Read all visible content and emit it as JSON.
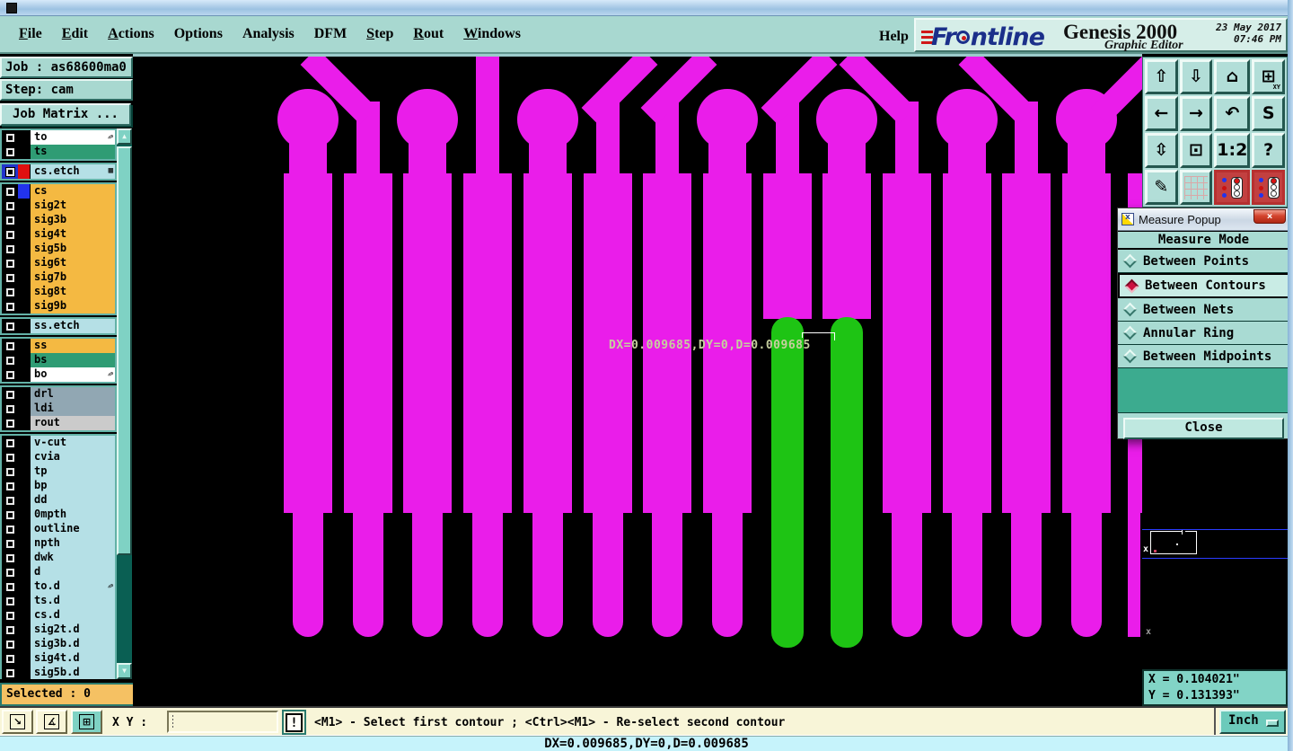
{
  "window": {
    "help_label": "Help"
  },
  "menu": {
    "items": [
      {
        "label": "File",
        "u": true
      },
      {
        "label": "Edit",
        "u": true
      },
      {
        "label": "Actions",
        "u": true
      },
      {
        "label": "Options",
        "u": false
      },
      {
        "label": "Analysis",
        "u": false
      },
      {
        "label": "DFM",
        "u": false
      },
      {
        "label": "Step",
        "u": true
      },
      {
        "label": "Rout",
        "u": true
      },
      {
        "label": "Windows",
        "u": true
      }
    ]
  },
  "brand": {
    "logo_text": "Frontline",
    "product": "Genesis 2000",
    "date": "23 May 2017",
    "time": "07:46 PM",
    "subtitle": "Graphic Editor"
  },
  "sidebar": {
    "job_label": "Job : as68600ma0",
    "step_label": "Step: cam",
    "job_matrix_label": "Job Matrix ...",
    "selected_label": "Selected : 0",
    "colors": {
      "white": "#ffffff",
      "green": "#2f9c74",
      "cyan": "#b5e0e6",
      "orange": "#f4b942",
      "slate": "#91a7b3",
      "gray": "#cbcbcb"
    },
    "groups": [
      [
        {
          "label": "to",
          "bg": "white",
          "arrow": true
        },
        {
          "label": "ts",
          "bg": "green"
        }
      ],
      [
        {
          "label": "cs.etch",
          "bg": "cyan",
          "swatch": "#e01010",
          "checkbox_hl": "#2233cc",
          "grid": true
        }
      ],
      [
        {
          "label": "cs",
          "bg": "orange",
          "swatch": "#2233ee"
        },
        {
          "label": "sig2t",
          "bg": "orange"
        },
        {
          "label": "sig3b",
          "bg": "orange"
        },
        {
          "label": "sig4t",
          "bg": "orange"
        },
        {
          "label": "sig5b",
          "bg": "orange"
        },
        {
          "label": "sig6t",
          "bg": "orange"
        },
        {
          "label": "sig7b",
          "bg": "orange"
        },
        {
          "label": "sig8t",
          "bg": "orange"
        },
        {
          "label": "sig9b",
          "bg": "orange"
        }
      ],
      [
        {
          "label": "ss.etch",
          "bg": "cyan"
        }
      ],
      [
        {
          "label": "ss",
          "bg": "orange"
        },
        {
          "label": "bs",
          "bg": "green"
        },
        {
          "label": "bo",
          "bg": "white",
          "arrow": true
        }
      ],
      [
        {
          "label": "drl",
          "bg": "slate"
        },
        {
          "label": "ldi",
          "bg": "slate"
        },
        {
          "label": "rout",
          "bg": "gray"
        }
      ],
      [
        {
          "label": "v-cut",
          "bg": "cyan"
        },
        {
          "label": "cvia",
          "bg": "cyan"
        },
        {
          "label": "tp",
          "bg": "cyan"
        },
        {
          "label": "bp",
          "bg": "cyan"
        },
        {
          "label": "dd",
          "bg": "cyan"
        },
        {
          "label": "0mpth",
          "bg": "cyan"
        },
        {
          "label": "outline",
          "bg": "cyan"
        },
        {
          "label": "npth",
          "bg": "cyan"
        },
        {
          "label": "dwk",
          "bg": "cyan"
        },
        {
          "label": "d",
          "bg": "cyan"
        },
        {
          "label": "to.d",
          "bg": "cyan",
          "arrow": true
        },
        {
          "label": "ts.d",
          "bg": "cyan"
        },
        {
          "label": "cs.d",
          "bg": "cyan"
        },
        {
          "label": "sig2t.d",
          "bg": "cyan"
        },
        {
          "label": "sig3b.d",
          "bg": "cyan"
        },
        {
          "label": "sig4t.d",
          "bg": "cyan"
        },
        {
          "label": "sig5b.d",
          "bg": "cyan"
        }
      ]
    ]
  },
  "toolbar": {
    "buttons": [
      {
        "name": "view-page-up-icon",
        "glyph": "⇧"
      },
      {
        "name": "view-page-down-icon",
        "glyph": "⇩"
      },
      {
        "name": "home-view-icon",
        "glyph": "⌂"
      },
      {
        "name": "window-xy-icon",
        "glyph": "⊞",
        "sub": "XY"
      },
      {
        "name": "pan-left-icon",
        "glyph": "←"
      },
      {
        "name": "pan-right-icon",
        "glyph": "→"
      },
      {
        "name": "undo-icon",
        "glyph": "↶"
      },
      {
        "name": "route-s-icon",
        "glyph": "S"
      },
      {
        "name": "zoom-extents-icon",
        "glyph": "⇳"
      },
      {
        "name": "zoom-center-icon",
        "glyph": "⊡"
      },
      {
        "name": "scale-ratio-icon",
        "glyph": "1:2"
      },
      {
        "name": "help-icon",
        "glyph": "?"
      },
      {
        "name": "tools-icon",
        "glyph": "✎"
      },
      {
        "name": "grid-icon",
        "glyph": "",
        "grid": true
      },
      {
        "name": "layer-traffic-left-icon",
        "traffic": true
      },
      {
        "name": "layer-traffic-right-icon",
        "traffic": true
      }
    ]
  },
  "popup": {
    "title": "Measure Popup",
    "close_glyph": "×",
    "header": "Measure Mode",
    "options": [
      {
        "label": "Between Points",
        "selected": false
      },
      {
        "label": "Between Contours",
        "selected": true
      },
      {
        "label": "Between Nets",
        "selected": false
      },
      {
        "label": "Annular Ring",
        "selected": false
      },
      {
        "label": "Between Midpoints",
        "selected": false
      }
    ],
    "close_label": "Close"
  },
  "canvas": {
    "measure_text": "DX=0.009685,DY=0,D=0.009685",
    "trace_color": "#ea1dea",
    "highlight_color": "#1ec414"
  },
  "coords": {
    "x_label": "X = 0.104021\"",
    "y_label": "Y = 0.131393\""
  },
  "bottom": {
    "xy_label": "X Y :",
    "input_value": "",
    "alert_label": "!",
    "message": "<M1> - Select first contour ; <Ctrl><M1> - Re-select second contour",
    "unit_label": "Inch"
  },
  "status": {
    "text": "DX=0.009685,DY=0,D=0.009685"
  }
}
